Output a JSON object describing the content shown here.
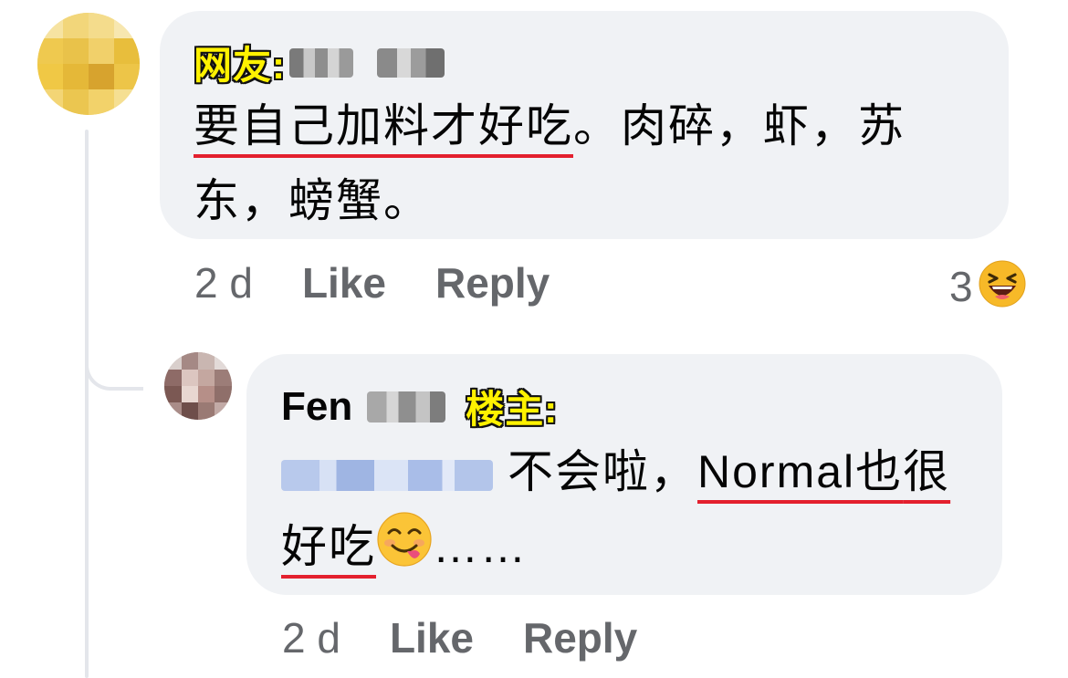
{
  "comments": [
    {
      "tag": "网友:",
      "text_underlined": "要自己加料才好吃",
      "text_rest": "。肉碎，虾，苏东，螃蟹。",
      "time": "2 d",
      "like_label": "Like",
      "reply_label": "Reply",
      "reaction_count": "3",
      "reaction_icon": "laughing-emoji-icon"
    },
    {
      "author_first_name": "Fen",
      "tag": "楼主:",
      "text_before": "不会啦，",
      "text_underlined_1": "Normal也",
      "text_underlined_2": "很好吃",
      "text_after": "……",
      "emoji": "yum-emoji-icon",
      "time": "2 d",
      "like_label": "Like",
      "reply_label": "Reply"
    }
  ],
  "colors": {
    "bubble": "#f0f2f5",
    "underline": "#e3202e",
    "tag_fill": "#fff200",
    "meta_text": "#65676b"
  }
}
